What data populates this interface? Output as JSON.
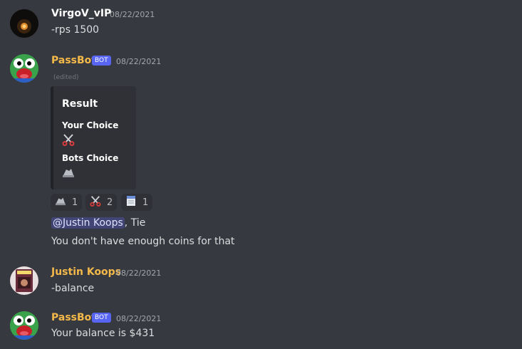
{
  "messages": [
    {
      "user": "VirgoV_vIP",
      "user_color": "#ffffff",
      "timestamp": "08/22/2021",
      "text": "-rps 1500"
    },
    {
      "user": "PassBot",
      "user_color": "#f5b94a",
      "bot_tag": "BOT",
      "timestamp": "08/22/2021",
      "edited": "(edited)",
      "embed": {
        "title": "Result",
        "fields": [
          {
            "name": "Your Choice",
            "value_icon": "scissors-icon"
          },
          {
            "name": "Bots Choice",
            "value_icon": "rock-icon"
          }
        ]
      },
      "reactions": [
        {
          "icon": "rock-icon",
          "count": "1"
        },
        {
          "icon": "scissors-icon",
          "count": "2"
        },
        {
          "icon": "paper-icon",
          "count": "1"
        }
      ],
      "mention": "@Justin Koops",
      "line1_suffix": ", Tie",
      "line2": "You don't have enough coins for that"
    },
    {
      "user": "Justin Koops",
      "user_color": "#f5b94a",
      "timestamp": "08/22/2021",
      "text": "-balance"
    },
    {
      "user": "PassBot",
      "user_color": "#f5b94a",
      "bot_tag": "BOT",
      "timestamp": "08/22/2021",
      "text": "Your balance is $431"
    }
  ]
}
